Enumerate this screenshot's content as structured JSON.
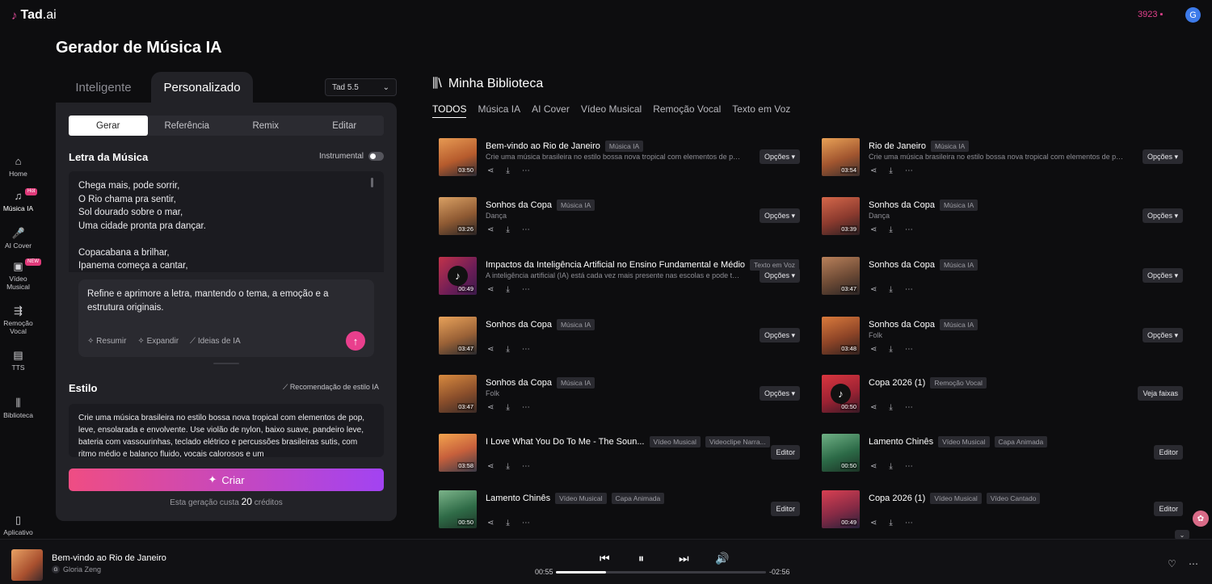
{
  "brand": {
    "mark": "♪",
    "name": "Tad",
    "suffix": ".ai"
  },
  "header": {
    "credits": "3923",
    "avatar_letter": "G"
  },
  "sidebar": {
    "items": [
      {
        "label": "Home",
        "icon": "home-icon",
        "glyph": "⌂"
      },
      {
        "label": "Música IA",
        "icon": "music-icon",
        "glyph": "♫",
        "badge": "Hot"
      },
      {
        "label": "AI Cover",
        "icon": "mic-icon",
        "glyph": "🎤"
      },
      {
        "label": "Vídeo Musical",
        "icon": "video-icon",
        "glyph": "▣",
        "badge": "NEW"
      },
      {
        "label": "Remoção Vocal",
        "icon": "split-icon",
        "glyph": "⇶"
      },
      {
        "label": "TTS",
        "icon": "tts-icon",
        "glyph": "▤"
      },
      {
        "label": "Biblioteca",
        "icon": "library-icon",
        "glyph": "⫼"
      },
      {
        "label": "Aplicativo",
        "icon": "phone-icon",
        "glyph": "▯"
      }
    ]
  },
  "generator": {
    "title": "Gerador de Música IA",
    "mode_tabs": [
      "Inteligente",
      "Personalizado"
    ],
    "model": "Tad 5.5",
    "sub_tabs": [
      "Gerar",
      "Referência",
      "Remix",
      "Editar"
    ],
    "lyrics_label": "Letra da Música",
    "instrumental_label": "Instrumental",
    "lyrics": "Chega mais, pode sorrir,\nO Rio chama pra sentir,\nSol dourado sobre o mar,\nUma cidade pronta pra dançar.\n\nCopacabana a brilhar,\nIpanema começa a cantar,",
    "refine_text": "Refine e aprimore a letra, mantendo o tema, a emoção e a estrutura originais.",
    "refine_actions": [
      "Resumir",
      "Expandir",
      "Ideias de IA"
    ],
    "style_label": "Estilo",
    "style_rec": "Recomendação de estilo IA",
    "style_text": "Crie uma música brasileira no estilo bossa nova tropical com elementos de pop, leve, ensolarada e envolvente. Use violão de nylon, baixo suave, pandeiro leve, bateria com vassourinhas, teclado elétrico e percussões brasileiras sutis, com ritmo médio e balanço fluido, vocais calorosos e um",
    "create_label": "Criar",
    "cost_prefix": "Esta geração custa",
    "cost_value": "20",
    "cost_suffix": "créditos"
  },
  "library": {
    "title": "Minha Biblioteca",
    "tabs": [
      "TODOS",
      "Música IA",
      "AI Cover",
      "Vídeo Musical",
      "Remoção Vocal",
      "Texto em Voz"
    ],
    "left": [
      {
        "title": "Bem-vindo ao Rio de Janeiro",
        "tags": [
          "Música IA"
        ],
        "sub": "Crie uma música brasileira no estilo bossa nova tropical com elementos de pop,...",
        "dur": "03:50",
        "btn": "Opções ▾",
        "bg": "linear-gradient(160deg,#e79a53,#b65b2d 55%,#2b2a33)"
      },
      {
        "title": "Sonhos da Copa",
        "tags": [
          "Música IA"
        ],
        "sub": "Dança",
        "dur": "03:26",
        "btn": "Opções ▾",
        "bg": "linear-gradient(160deg,#d9a064,#8f5a33 55%,#2a2424)"
      },
      {
        "title": "Impactos da Inteligência Artificial no Ensino Fundamental e Médio",
        "tags": [
          "Texto em Voz"
        ],
        "sub": "A inteligência artificial (IA) está cada vez mais presente nas escolas e pode transformar a forma...",
        "dur": "00:49",
        "btn": "Opções ▾",
        "bg": "linear-gradient(135deg,#c2324a,#6b1d57 60%,#3a1a4a)",
        "note": true
      },
      {
        "title": "Sonhos da Copa",
        "tags": [
          "Música IA"
        ],
        "sub": "",
        "dur": "03:47",
        "btn": "Opções ▾",
        "bg": "linear-gradient(160deg,#e8a25a,#9b6237 55%,#2a2a2e)"
      },
      {
        "title": "Sonhos da Copa",
        "tags": [
          "Música IA"
        ],
        "sub": "Folk",
        "dur": "03:47",
        "btn": "Opções ▾",
        "bg": "linear-gradient(160deg,#d88a3f,#8a4e2b 55%,#3a2a26)"
      },
      {
        "title": "I Love What You Do To Me - The Soun...",
        "tags": [
          "Vídeo Musical",
          "Videoclipe Narra..."
        ],
        "sub": "",
        "dur": "03:58",
        "btn": "Editor",
        "bg": "linear-gradient(160deg,#f3a44e,#c7603c 50%,#3b3a47)"
      },
      {
        "title": "Lamento Chinês",
        "tags": [
          "Vídeo Musical",
          "Capa Animada"
        ],
        "sub": "",
        "dur": "00:50",
        "btn": "Editor",
        "bg": "linear-gradient(160deg,#7cb48a,#2f6b47 55%,#1c3326)"
      }
    ],
    "right": [
      {
        "title": "Rio de Janeiro",
        "tags": [
          "Música IA"
        ],
        "sub": "Crie uma música brasileira no estilo bossa nova tropical com elementos de pop,...",
        "dur": "03:54",
        "btn": "Opções ▾",
        "bg": "linear-gradient(160deg,#e8a156,#a1552f 55%,#3a2f2d)"
      },
      {
        "title": "Sonhos da Copa",
        "tags": [
          "Música IA"
        ],
        "sub": "Dança",
        "dur": "03:39",
        "btn": "Opções ▾",
        "bg": "linear-gradient(160deg,#d4674a,#8b3a2e 55%,#2a1f22)"
      },
      {
        "title": "Sonhos da Copa",
        "tags": [
          "Música IA"
        ],
        "sub": "",
        "dur": "03:47",
        "btn": "Opções ▾",
        "bg": "linear-gradient(160deg,#b8805a,#6d4a35 55%,#2a2424)"
      },
      {
        "title": "Sonhos da Copa",
        "tags": [
          "Música IA"
        ],
        "sub": "Folk",
        "dur": "03:48",
        "btn": "Opções ▾",
        "bg": "linear-gradient(160deg,#d97a3c,#8d4427 55%,#33221f)"
      },
      {
        "title": "Copa 2026 (1)",
        "tags": [
          "Remoção Vocal"
        ],
        "sub": "",
        "dur": "00:50",
        "btn": "Veja faixas",
        "bg": "linear-gradient(160deg,#d9363f,#9c2233 55%,#3a1a26)",
        "note": true
      },
      {
        "title": "Lamento Chinês",
        "tags": [
          "Vídeo Musical",
          "Capa Animada"
        ],
        "sub": "",
        "dur": "00:50",
        "btn": "Editor",
        "bg": "linear-gradient(160deg,#6fb085,#2c6a47 55%,#1b3325)"
      },
      {
        "title": "Copa 2026 (1)",
        "tags": [
          "Vídeo Musical",
          "Vídeo Cantado"
        ],
        "sub": "",
        "dur": "00:49",
        "btn": "Editor",
        "bg": "linear-gradient(160deg,#d94052,#862a45 55%,#26213a)"
      }
    ]
  },
  "player": {
    "title": "Bem-vindo ao Rio de Janeiro",
    "artist": "Gloria Zeng",
    "artist_initial": "G",
    "elapsed": "00:55",
    "remaining": "-02:56",
    "progress": 0.237
  }
}
